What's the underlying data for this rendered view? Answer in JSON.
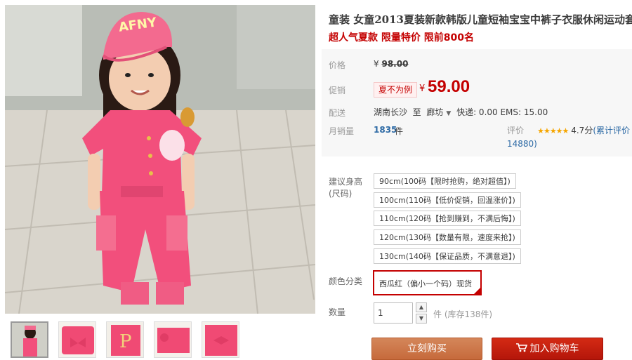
{
  "product": {
    "title": "童装 女童2013夏装新款韩版儿童短袖宝宝中裤子衣服休闲运动套装",
    "subtitle": "超人气夏款 限量特价 限前800名"
  },
  "gallery": {
    "hat_text": "AFNY",
    "thumbnails": [
      "thumb-1",
      "thumb-2",
      "thumb-3",
      "thumb-4",
      "thumb-5"
    ]
  },
  "price": {
    "label": "价格",
    "currency": "¥",
    "original": "98.00"
  },
  "promo": {
    "label": "促销",
    "tag": "夏不为例",
    "currency": "¥",
    "price": "59.00"
  },
  "shipping": {
    "label": "配送",
    "from": "湖南长沙",
    "to_word": "至",
    "destination": "廊坊",
    "fees": "快递: 0.00 EMS: 15.00"
  },
  "sales": {
    "label": "月销量",
    "count": "1835",
    "unit": "件"
  },
  "rating": {
    "label": "评价",
    "score": "4.7分",
    "total_text": "(累计评价14880)",
    "stars": 4.7
  },
  "sku": {
    "size_label": "建议身高(尺码)",
    "sizes": [
      "90cm(100码【限时抢购，绝对超值】)",
      "100cm(110码【低价促销，回温涨价】)",
      "110cm(120码【抢到赚到，不满后悔】)",
      "120cm(130码【数量有限，速度来抢】)",
      "130cm(140码【保证品质，不满意退】)"
    ],
    "color_label": "颜色分类",
    "color_selected": "西瓜红（偏小一个码）现货"
  },
  "quantity": {
    "label": "数量",
    "value": "1",
    "stock": "件 (库存138件)"
  },
  "actions": {
    "buy_now": "立刻购买",
    "add_to_cart": "加入购物车"
  },
  "colors": {
    "accent": "#c40000",
    "buy_button": "#c96f42",
    "cart_button": "#c11f0e",
    "link": "#2d6aa5",
    "star": "#f6a600",
    "outfit_pink": "#f24f7c"
  }
}
